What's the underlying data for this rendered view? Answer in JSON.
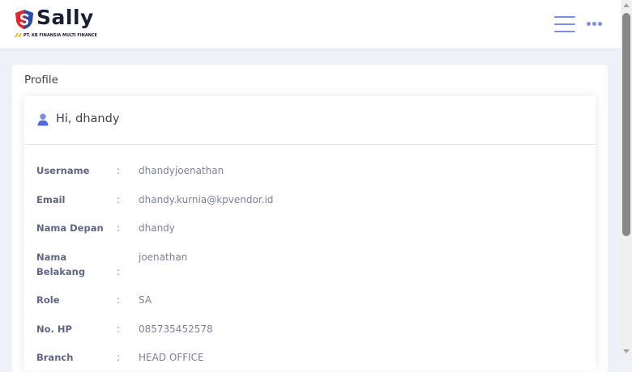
{
  "brand": {
    "name": "Sally",
    "tagline": "PT. KB FINANSIA MULTI FINANCE"
  },
  "header": {
    "menu_icon": "hamburger-icon",
    "more_icon": "more-horizontal-icon"
  },
  "page": {
    "section_title": "Profile",
    "greeting": "Hi, dhandy",
    "greeting_icon": "user-icon"
  },
  "profile": {
    "separator": ":",
    "fields": [
      {
        "label": "Username",
        "value": "dhandyjoenathan"
      },
      {
        "label": "Email",
        "value": "dhandy.kurnia@kpvendor.id"
      },
      {
        "label": "Nama Depan",
        "value": "dhandy"
      },
      {
        "label": "Nama Belakang",
        "value": "joenathan"
      },
      {
        "label": "Role",
        "value": "SA"
      },
      {
        "label": "No. HP",
        "value": "085735452578"
      },
      {
        "label": "Branch",
        "value": "HEAD OFFICE"
      }
    ]
  },
  "colors": {
    "accent": "#7b8ee6",
    "brand_red": "#e4252d",
    "brand_blue": "#2b4aa8",
    "page_bg": "#eef2f8"
  }
}
